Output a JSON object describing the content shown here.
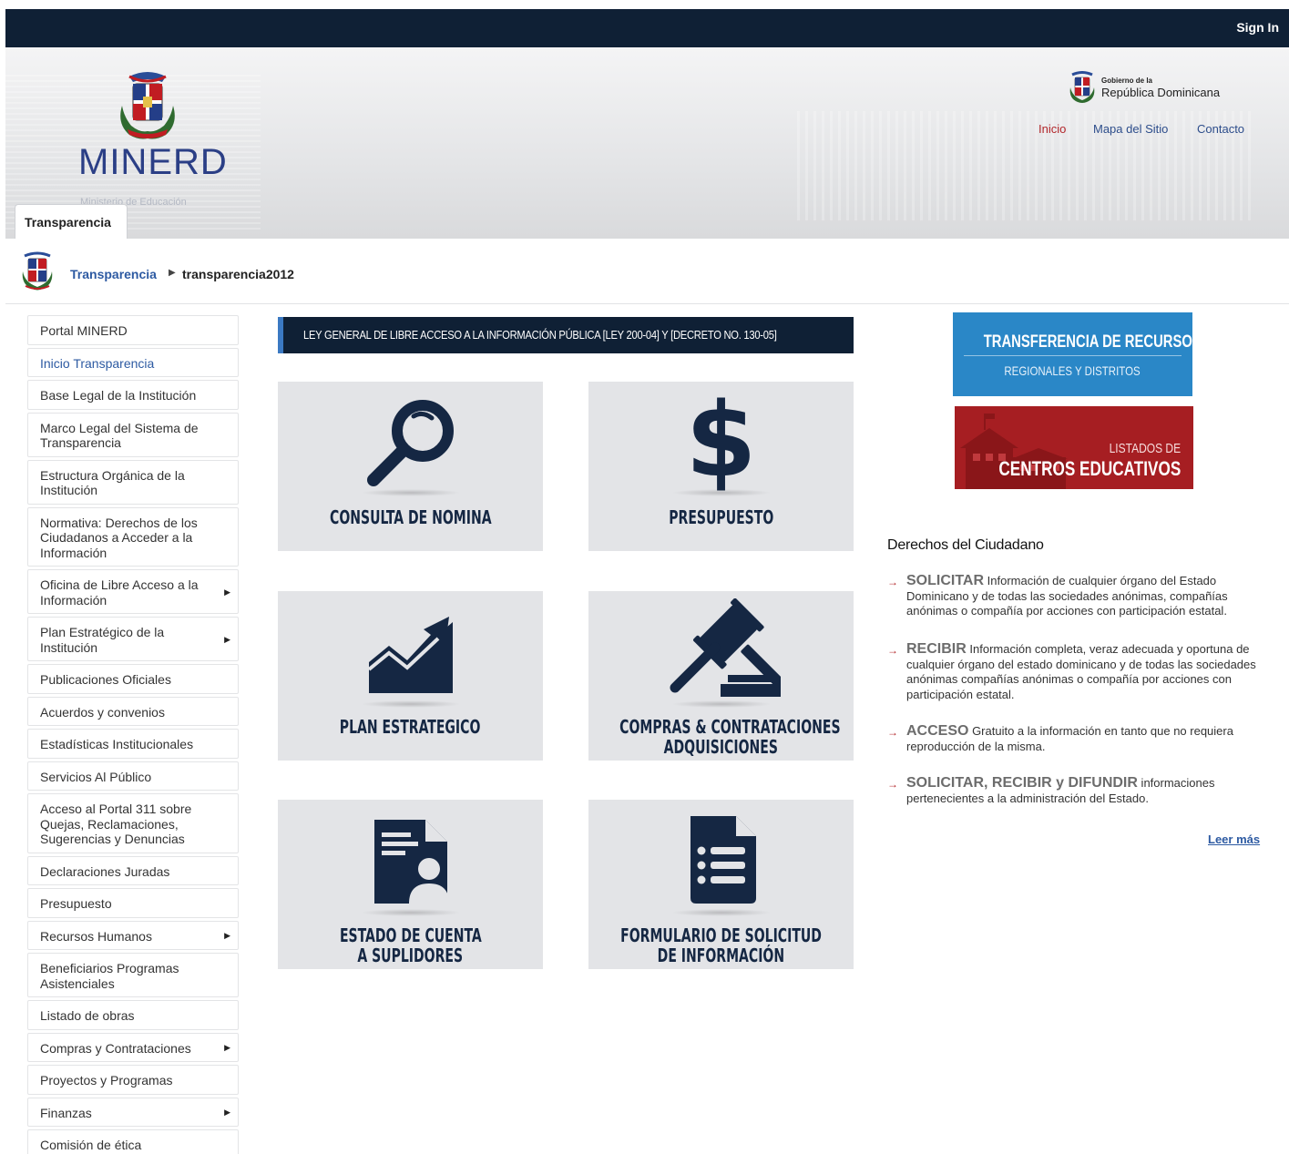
{
  "topbar": {
    "signin": "Sign In"
  },
  "header": {
    "logo_text": "MINERD",
    "logo_sub": "Ministerio de Educación",
    "gov_small": "Gobierno de la",
    "gov_big": "República Dominicana",
    "links": [
      "Inicio",
      "Mapa del Sitio",
      "Contacto"
    ],
    "tab": "Transparencia"
  },
  "breadcrumb": {
    "link": "Transparencia",
    "current": "transparencia2012"
  },
  "sidebar": {
    "items": [
      {
        "label": "Portal MINERD",
        "arrow": false,
        "active": false
      },
      {
        "label": "Inicio Transparencia",
        "arrow": false,
        "active": true
      },
      {
        "label": "Base Legal de la Institución",
        "arrow": false,
        "active": false
      },
      {
        "label": "Marco Legal del Sistema de Transparencia",
        "arrow": false,
        "active": false
      },
      {
        "label": "Estructura Orgánica de la Institución",
        "arrow": false,
        "active": false
      },
      {
        "label": "Normativa: Derechos de los Ciudadanos a Acceder a la Información",
        "arrow": false,
        "active": false
      },
      {
        "label": "Oficina de Libre Acceso a la Información",
        "arrow": true,
        "active": false
      },
      {
        "label": "Plan Estratégico de la Institución",
        "arrow": true,
        "active": false
      },
      {
        "label": "Publicaciones Oficiales",
        "arrow": false,
        "active": false
      },
      {
        "label": "Acuerdos y convenios",
        "arrow": false,
        "active": false
      },
      {
        "label": "Estadísticas Institucionales",
        "arrow": false,
        "active": false
      },
      {
        "label": "Servicios Al Público",
        "arrow": false,
        "active": false
      },
      {
        "label": "Acceso al Portal 311 sobre Quejas, Reclamaciones, Sugerencias y Denuncias",
        "arrow": false,
        "active": false
      },
      {
        "label": "Declaraciones Juradas",
        "arrow": false,
        "active": false
      },
      {
        "label": "Presupuesto",
        "arrow": false,
        "active": false
      },
      {
        "label": "Recursos Humanos",
        "arrow": true,
        "active": false
      },
      {
        "label": "Beneficiarios Programas Asistenciales",
        "arrow": false,
        "active": false
      },
      {
        "label": "Listado de obras",
        "arrow": false,
        "active": false
      },
      {
        "label": "Compras y Contrataciones",
        "arrow": true,
        "active": false
      },
      {
        "label": "Proyectos y Programas",
        "arrow": false,
        "active": false
      },
      {
        "label": "Finanzas",
        "arrow": true,
        "active": false
      },
      {
        "label": "Comisión de ética",
        "arrow": false,
        "active": false
      }
    ]
  },
  "main": {
    "law_banner": "LEY GENERAL DE LIBRE ACCESO A LA INFORMACIÓN PÚBLICA [LEY 200-04] Y [DECRETO NO. 130-05]",
    "tiles": [
      {
        "line1": "CONSULTA DE NOMINA",
        "line2": "",
        "icon": "magnifier-icon"
      },
      {
        "line1": "PRESUPUESTO",
        "line2": "",
        "icon": "dollar-icon"
      },
      {
        "line1": "PLAN ESTRATEGICO",
        "line2": "",
        "icon": "trend-chart-icon"
      },
      {
        "line1": "COMPRAS & CONTRATACIONES",
        "line2": "ADQUISICIONES",
        "icon": "gavel-icon"
      },
      {
        "line1": "ESTADO DE CUENTA",
        "line2": "A SUPLIDORES",
        "icon": "document-person-icon"
      },
      {
        "line1": "FORMULARIO DE SOLICITUD",
        "line2": "DE INFORMACIÓN",
        "icon": "document-list-icon"
      }
    ]
  },
  "right": {
    "banner1": {
      "title": "TRANSFERENCIA DE RECURSOS",
      "subtitle": "REGIONALES Y DISTRITOS"
    },
    "banner2": {
      "line1": "LISTADOS DE",
      "line2": "CENTROS EDUCATIVOS"
    },
    "rights_title": "Derechos del Ciudadano",
    "rights": [
      {
        "kw": "SOLICITAR",
        "text": " Información de cualquier órgano del Estado Dominicano y de todas las sociedades anónimas, compañías anónimas o compañía por acciones con participación estatal."
      },
      {
        "kw": "RECIBIR",
        "text": " Información completa, veraz adecuada y  oportuna de cualquier órgano del estado dominicano y de todas las sociedades anónimas compañías anónimas o compañía por acciones con participación estatal."
      },
      {
        "kw": "ACCESO",
        "text": " Gratuito a la información en tanto que no requiera reproducción de la misma."
      },
      {
        "kw": "SOLICITAR, RECIBIR y DIFUNDIR",
        "text": " informaciones pertenecientes a la administración del Estado."
      }
    ],
    "leer_mas": "Leer más"
  },
  "colors": {
    "navy": "#0f2035",
    "blue": "#2a87c7",
    "red": "#a61e22",
    "link": "#2d5aa2",
    "accent_red": "#b2262a"
  }
}
